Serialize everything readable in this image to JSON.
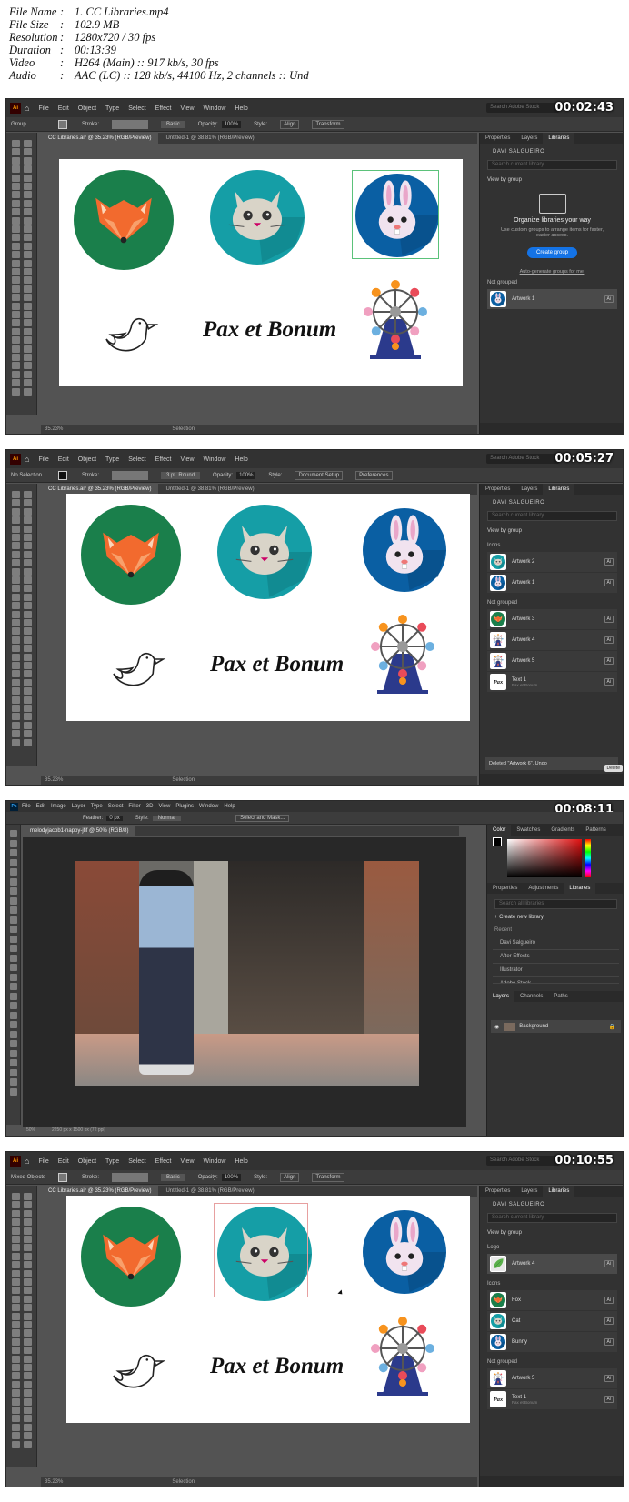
{
  "header": [
    {
      "key": "File Name",
      "value": "1. CC Libraries.mp4"
    },
    {
      "key": "File Size",
      "value": "102.9 MB"
    },
    {
      "key": "Resolution",
      "value": "1280x720 / 30 fps"
    },
    {
      "key": "Duration",
      "value": "00:13:39"
    },
    {
      "key": "Video",
      "value": "H264 (Main) :: 917 kb/s, 30 fps"
    },
    {
      "key": "Audio",
      "value": "AAC (LC) :: 128 kb/s, 44100 Hz, 2 channels :: Und"
    }
  ],
  "frames": [
    {
      "timestamp": "00:02:43",
      "app": "Ai",
      "menus": [
        "File",
        "Edit",
        "Object",
        "Type",
        "Select",
        "Effect",
        "View",
        "Window",
        "Help"
      ],
      "search": "Search Adobe Stock",
      "control": {
        "label": "Group",
        "stroke": "Stroke:",
        "brush": "Basic",
        "opacity": "Opacity:",
        "opacity_val": "100%",
        "style": "Style:",
        "align": "Align",
        "transform": "Transform"
      },
      "tabs": [
        "CC Libraries.ai* @ 35.23% (RGB/Preview)",
        "Untitled-1 @ 38.81% (RGB/Preview)"
      ],
      "artboard_text": "Pax et Bonum",
      "status": {
        "zoom": "35.23%",
        "mode": "Selection"
      },
      "panel": {
        "tabs": [
          "Properties",
          "Layers",
          "Libraries"
        ],
        "user": "DAVI SALGUEIRO",
        "search": "Search current library",
        "viewby": "View by group",
        "empty_title": "Organize libraries your way",
        "empty_desc": "Use custom groups to arrange items for faster, easier access.",
        "button": "Create group",
        "link": "Auto-generate groups for me.",
        "groups": [
          {
            "name": "Not grouped",
            "items": [
              {
                "name": "Artwork 1",
                "sub": "",
                "kind": "bunny",
                "sel": true
              }
            ]
          }
        ]
      }
    },
    {
      "timestamp": "00:05:27",
      "app": "Ai",
      "menus": [
        "File",
        "Edit",
        "Object",
        "Type",
        "Select",
        "Effect",
        "View",
        "Window",
        "Help"
      ],
      "search": "Search Adobe Stock",
      "control": {
        "label": "No Selection",
        "stroke": "Stroke:",
        "brush": "3 pt. Round",
        "opacity": "Opacity:",
        "opacity_val": "100%",
        "style": "Style:",
        "align": "Document Setup",
        "transform": "Preferences"
      },
      "tabs": [
        "CC Libraries.ai* @ 35.23% (RGB/Preview)",
        "Untitled-1 @ 38.81% (RGB/Preview)"
      ],
      "artboard_text": "Pax et Bonum",
      "status": {
        "zoom": "35.23%",
        "mode": "Selection"
      },
      "panel": {
        "tabs": [
          "Properties",
          "Layers",
          "Libraries"
        ],
        "user": "DAVI SALGUEIRO",
        "search": "Search current library",
        "viewby": "View by group",
        "groups": [
          {
            "name": "Icons",
            "items": [
              {
                "name": "Artwork 2",
                "sub": "",
                "kind": "cat",
                "sel": false
              },
              {
                "name": "Artwork 1",
                "sub": "",
                "kind": "bunny",
                "sel": false
              }
            ]
          },
          {
            "name": "Not grouped",
            "items": [
              {
                "name": "Artwork 3",
                "sub": "",
                "kind": "fox",
                "sel": false
              },
              {
                "name": "Artwork 4",
                "sub": "",
                "kind": "wheel",
                "sel": false
              },
              {
                "name": "Artwork 5",
                "sub": "",
                "kind": "wheel",
                "sel": false
              },
              {
                "name": "Text 1",
                "sub": "Pax et Bonum",
                "kind": "text",
                "sel": false
              }
            ]
          }
        ],
        "deleted": "Deleted \"Artwork 6\". Undo",
        "tooltip": "Delete"
      }
    },
    {
      "timestamp": "00:08:11",
      "app": "Ps",
      "menus": [
        "File",
        "Edit",
        "Image",
        "Layer",
        "Type",
        "Select",
        "Filter",
        "3D",
        "View",
        "Plugins",
        "Window",
        "Help"
      ],
      "control": {
        "feather": "Feather:",
        "feather_val": "0 px",
        "style": "Style:",
        "style_val": "Normal",
        "button": "Select and Mask..."
      },
      "tabs": [
        "melodyjacob1-nappy-jfif @ 50% (RGB/8)"
      ],
      "status": {
        "zoom": "50%",
        "mode": "2250 px x 1500 px (72 ppi)"
      },
      "panel": {
        "color_tabs": [
          "Color",
          "Swatches",
          "Gradients",
          "Patterns"
        ],
        "lib_tabs": [
          "Properties",
          "Adjustments",
          "Libraries"
        ],
        "search": "Search all libraries",
        "create": "+ Create new library",
        "recent": "Recent",
        "libs": [
          "Davi Salgueiro",
          "After Effects",
          "Illustrator",
          "Adobe Stock"
        ],
        "layer_tabs": [
          "Layers",
          "Channels",
          "Paths"
        ],
        "layer": "Background"
      }
    },
    {
      "timestamp": "00:10:55",
      "app": "Ai",
      "menus": [
        "File",
        "Edit",
        "Object",
        "Type",
        "Select",
        "Effect",
        "View",
        "Window",
        "Help"
      ],
      "search": "Search Adobe Stock",
      "control": {
        "label": "Mixed Objects",
        "stroke": "Stroke:",
        "brush": "Basic",
        "opacity": "Opacity:",
        "opacity_val": "100%",
        "style": "Style:",
        "align": "Align",
        "transform": "Transform"
      },
      "tabs": [
        "CC Libraries.ai* @ 35.23% (RGB/Preview)",
        "Untitled-1 @ 38.81% (RGB/Preview)"
      ],
      "artboard_text": "Pax et Bonum",
      "status": {
        "zoom": "35.23%",
        "mode": "Selection"
      },
      "panel": {
        "tabs": [
          "Properties",
          "Layers",
          "Libraries"
        ],
        "user": "DAVI SALGUEIRO",
        "search": "Search current library",
        "viewby": "View by group",
        "groups": [
          {
            "name": "Logo",
            "items": [
              {
                "name": "Artwork 4",
                "sub": "",
                "kind": "leaf",
                "sel": true
              }
            ]
          },
          {
            "name": "Icons",
            "items": [
              {
                "name": "Fox",
                "sub": "",
                "kind": "fox",
                "sel": false
              },
              {
                "name": "Cat",
                "sub": "",
                "kind": "cat",
                "sel": false
              },
              {
                "name": "Bunny",
                "sub": "",
                "kind": "bunny",
                "sel": false
              }
            ]
          },
          {
            "name": "Not grouped",
            "items": [
              {
                "name": "Artwork 5",
                "sub": "",
                "kind": "wheel",
                "sel": false
              },
              {
                "name": "Text 1",
                "sub": "Pax et Bonum",
                "kind": "text",
                "sel": false
              }
            ]
          }
        ]
      }
    }
  ],
  "colors": {
    "fox_bg": "#1a7f4b",
    "fox": "#f26a2e",
    "cat_bg": "#159ea6",
    "cat": "#d9d4c8",
    "bunny_bg": "#0a5fa3",
    "bunny": "#f1e3ef",
    "wheel_base": "#2b3a8c",
    "accent_blue": "#1473e6"
  }
}
